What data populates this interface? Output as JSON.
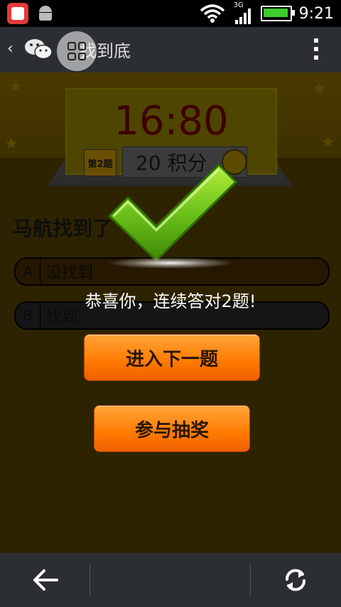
{
  "status_bar": {
    "network_type": "3G",
    "time": "9:21",
    "icons": [
      "app-notification-icon",
      "android-debug-icon",
      "wifi-icon",
      "signal-icon",
      "battery-icon"
    ]
  },
  "header": {
    "title": "找到底",
    "icons": [
      "back-chevron-icon",
      "wechat-icon",
      "floating-grid-icon",
      "overflow-menu-icon"
    ]
  },
  "quiz": {
    "timer": "16:80",
    "question_number": "第2题",
    "score": "20 积分",
    "question": "马航找到了",
    "options": [
      {
        "letter": "A",
        "label": "没找到"
      },
      {
        "letter": "B",
        "label": "找到"
      }
    ]
  },
  "result_modal": {
    "message": "恭喜你，连续答对2题!",
    "next_button": "进入下一题",
    "draw_button": "参与抽奖",
    "icon": "checkmark-icon"
  },
  "colors": {
    "accent_orange": "#ff7a00",
    "check_green": "#6cc21a",
    "bar_bg": "#2b2f33"
  },
  "bottom_nav": {
    "icons": [
      "back-arrow-icon",
      "refresh-icon"
    ]
  }
}
